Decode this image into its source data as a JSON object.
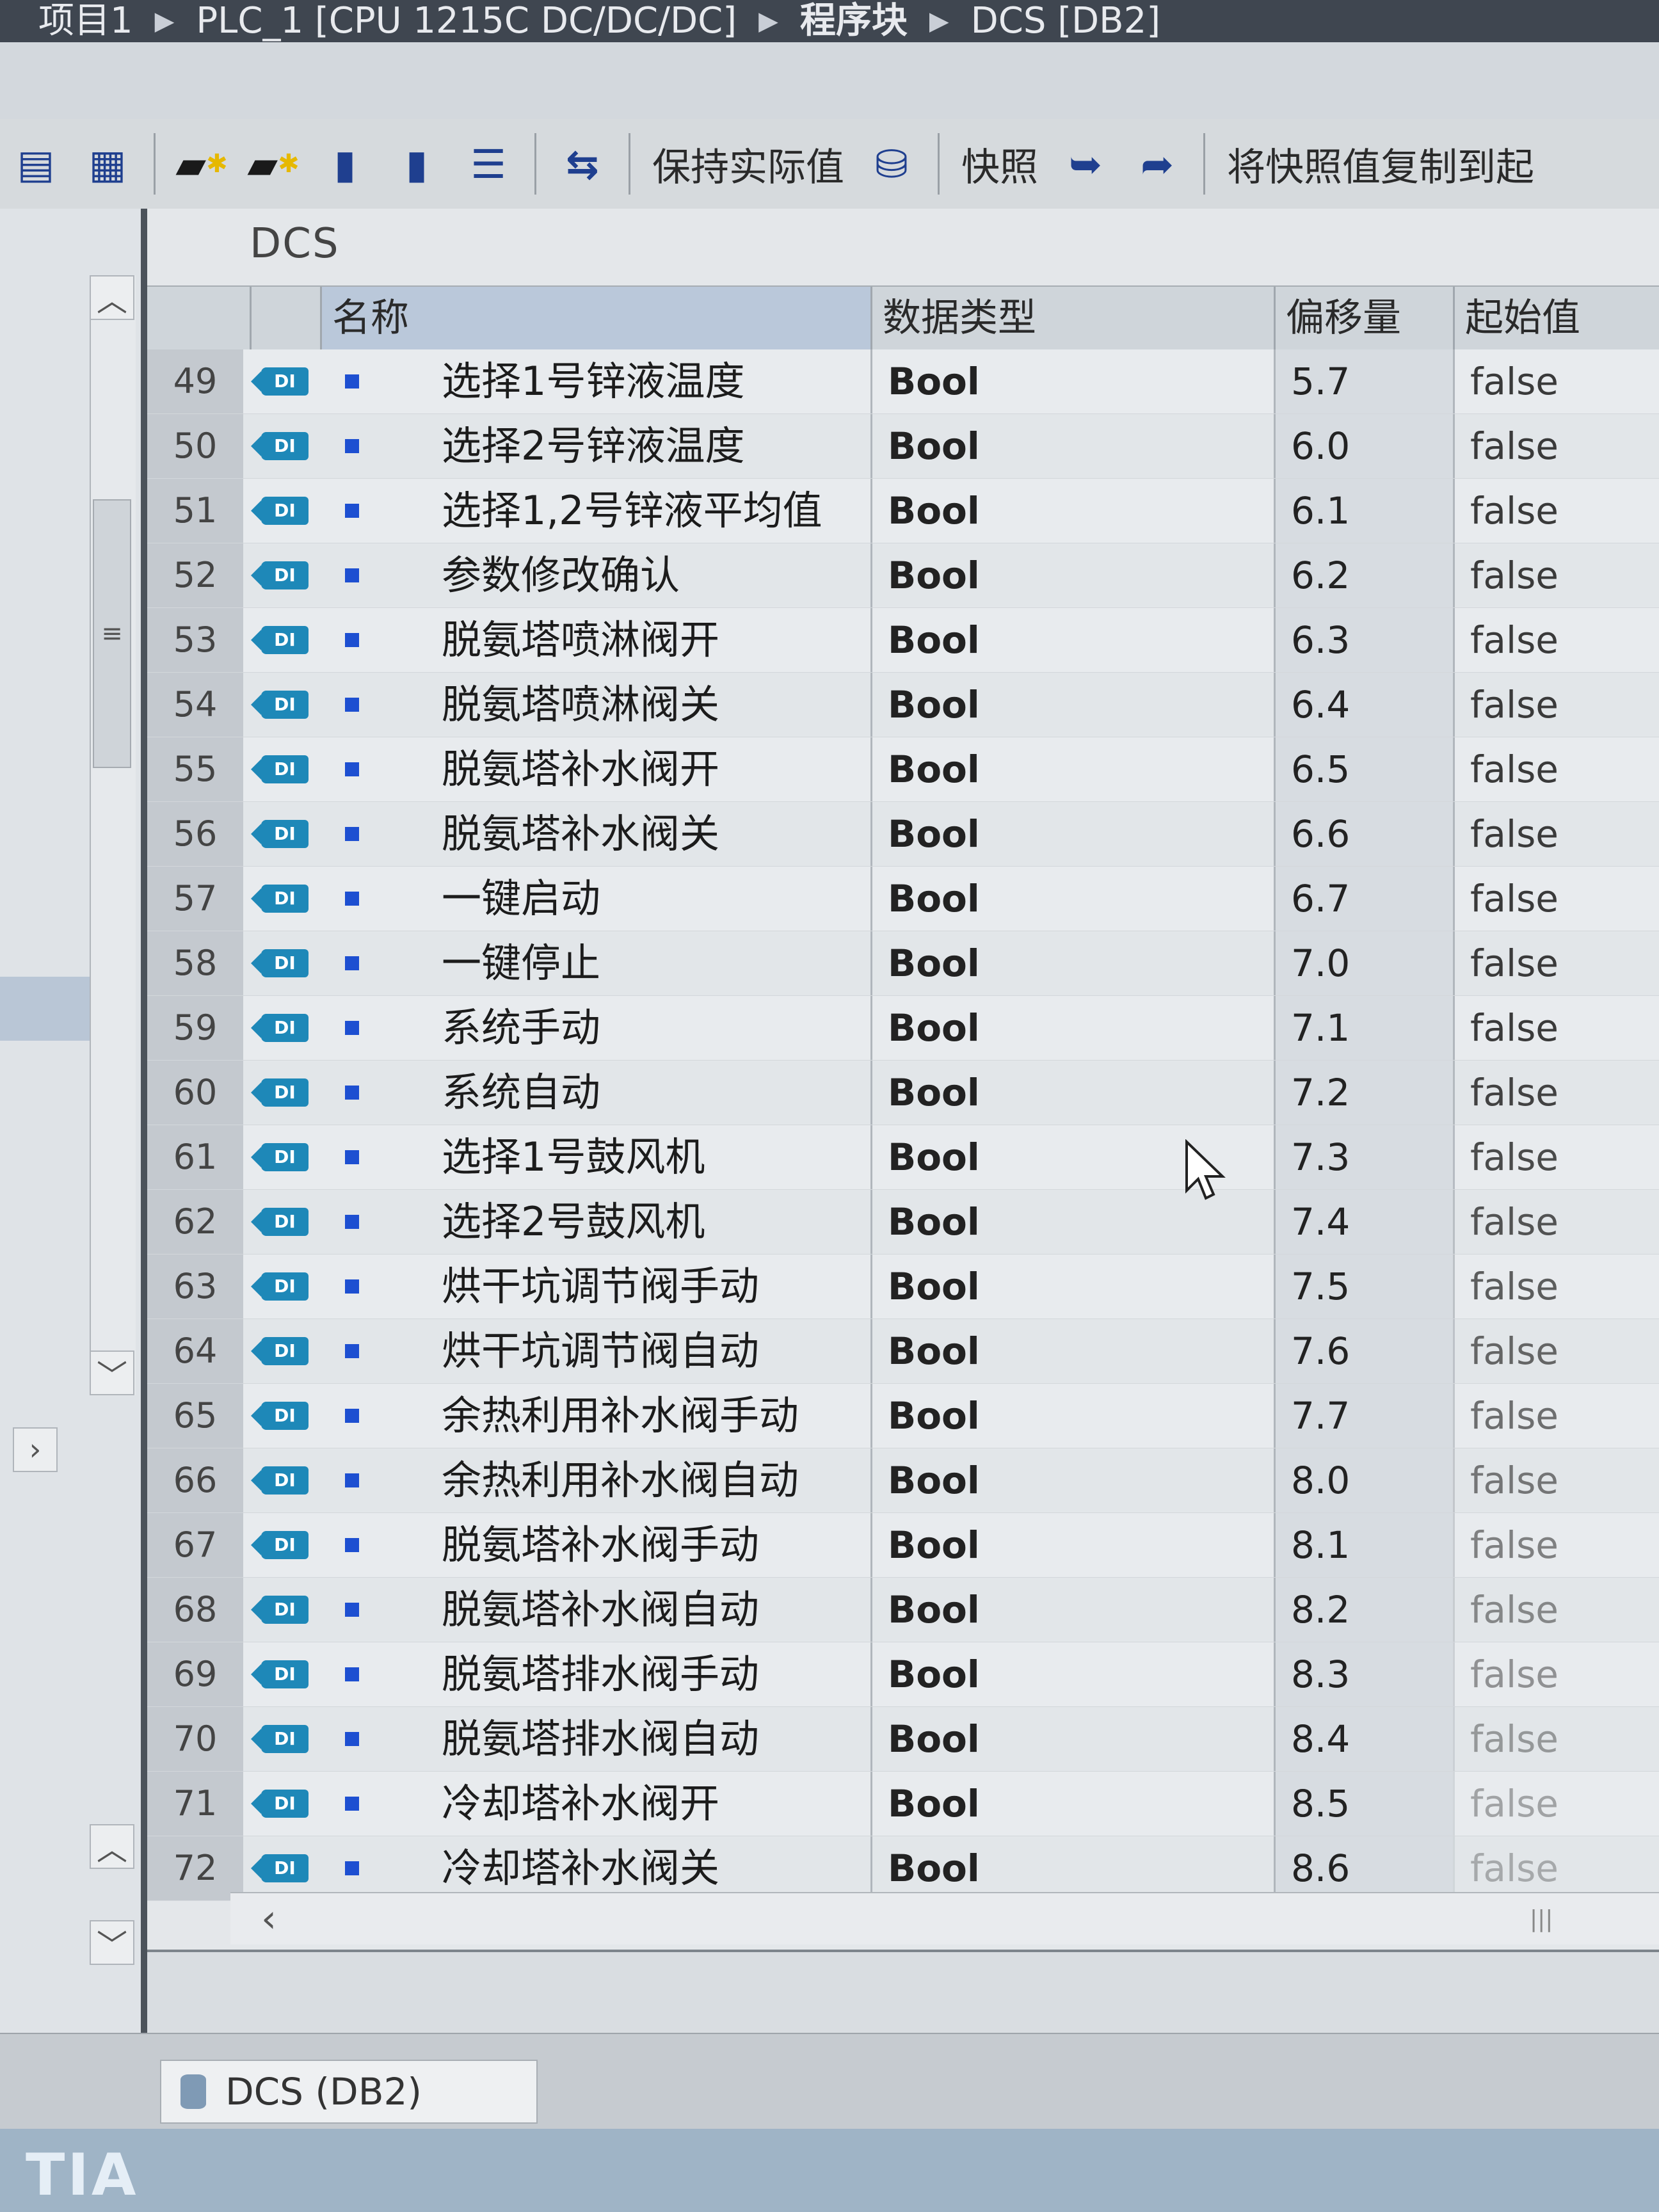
{
  "breadcrumb": {
    "project": "项目1",
    "device": "PLC_1 [CPU 1215C DC/DC/DC]",
    "folder": "程序块",
    "block": "DCS [DB2]"
  },
  "toolbar": {
    "keep_actual_values": "保持实际值",
    "snapshot": "快照",
    "copy_snapshot": "将快照值复制到起"
  },
  "block_title": "DCS",
  "table": {
    "headers": {
      "name": "名称",
      "data_type": "数据类型",
      "offset": "偏移量",
      "start_value": "起始值"
    },
    "rows": [
      {
        "num": "49",
        "name": "选择1号锌液温度",
        "type": "Bool",
        "offset": "5.7",
        "start": "false"
      },
      {
        "num": "50",
        "name": "选择2号锌液温度",
        "type": "Bool",
        "offset": "6.0",
        "start": "false"
      },
      {
        "num": "51",
        "name": "选择1,2号锌液平均值",
        "type": "Bool",
        "offset": "6.1",
        "start": "false"
      },
      {
        "num": "52",
        "name": "参数修改确认",
        "type": "Bool",
        "offset": "6.2",
        "start": "false"
      },
      {
        "num": "53",
        "name": "脱氨塔喷淋阀开",
        "type": "Bool",
        "offset": "6.3",
        "start": "false"
      },
      {
        "num": "54",
        "name": "脱氨塔喷淋阀关",
        "type": "Bool",
        "offset": "6.4",
        "start": "false"
      },
      {
        "num": "55",
        "name": "脱氨塔补水阀开",
        "type": "Bool",
        "offset": "6.5",
        "start": "false"
      },
      {
        "num": "56",
        "name": "脱氨塔补水阀关",
        "type": "Bool",
        "offset": "6.6",
        "start": "false"
      },
      {
        "num": "57",
        "name": "一键启动",
        "type": "Bool",
        "offset": "6.7",
        "start": "false"
      },
      {
        "num": "58",
        "name": "一键停止",
        "type": "Bool",
        "offset": "7.0",
        "start": "false"
      },
      {
        "num": "59",
        "name": "系统手动",
        "type": "Bool",
        "offset": "7.1",
        "start": "false"
      },
      {
        "num": "60",
        "name": "系统自动",
        "type": "Bool",
        "offset": "7.2",
        "start": "false"
      },
      {
        "num": "61",
        "name": "选择1号鼓风机",
        "type": "Bool",
        "offset": "7.3",
        "start": "false"
      },
      {
        "num": "62",
        "name": "选择2号鼓风机",
        "type": "Bool",
        "offset": "7.4",
        "start": "false"
      },
      {
        "num": "63",
        "name": "烘干坑调节阀手动",
        "type": "Bool",
        "offset": "7.5",
        "start": "false"
      },
      {
        "num": "64",
        "name": "烘干坑调节阀自动",
        "type": "Bool",
        "offset": "7.6",
        "start": "false"
      },
      {
        "num": "65",
        "name": "余热利用补水阀手动",
        "type": "Bool",
        "offset": "7.7",
        "start": "false"
      },
      {
        "num": "66",
        "name": "余热利用补水阀自动",
        "type": "Bool",
        "offset": "8.0",
        "start": "false"
      },
      {
        "num": "67",
        "name": "脱氨塔补水阀手动",
        "type": "Bool",
        "offset": "8.1",
        "start": "false"
      },
      {
        "num": "68",
        "name": "脱氨塔补水阀自动",
        "type": "Bool",
        "offset": "8.2",
        "start": "false"
      },
      {
        "num": "69",
        "name": "脱氨塔排水阀手动",
        "type": "Bool",
        "offset": "8.3",
        "start": "false"
      },
      {
        "num": "70",
        "name": "脱氨塔排水阀自动",
        "type": "Bool",
        "offset": "8.4",
        "start": "false"
      },
      {
        "num": "71",
        "name": "冷却塔补水阀开",
        "type": "Bool",
        "offset": "8.5",
        "start": "false"
      },
      {
        "num": "72",
        "name": "冷却塔补水阀关",
        "type": "Bool",
        "offset": "8.6",
        "start": "false"
      }
    ]
  },
  "icons": {
    "row_icon": "db-input-tag-icon",
    "row_marker": "retain-square-icon"
  },
  "db_tag_label": "DI",
  "bottom_tab": {
    "label": "DCS (DB2)"
  },
  "status": {
    "logo": "TIA"
  },
  "colors": {
    "accent": "#1e88b8",
    "marker": "#1d4fd1",
    "header_sel": "#bac8da"
  }
}
